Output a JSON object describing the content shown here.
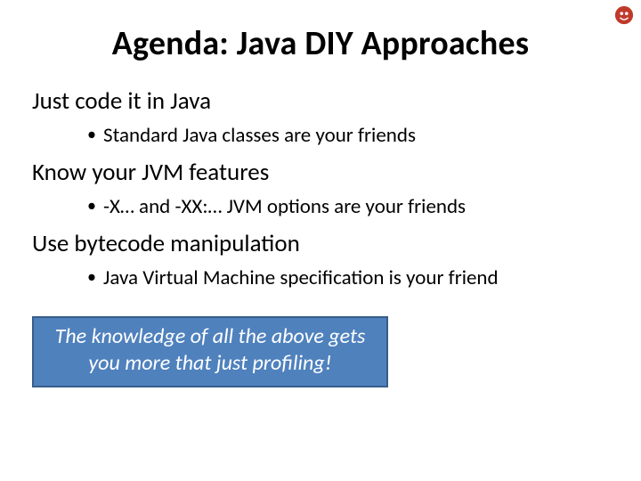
{
  "title": "Agenda: Java DIY Approaches",
  "items": [
    {
      "text": "Just code it in Java",
      "sub": [
        "Standard Java classes are your friends"
      ]
    },
    {
      "text": "Know your JVM features",
      "sub": [
        "-X… and -XX:… JVM options are your friends"
      ]
    },
    {
      "text": "Use bytecode manipulation",
      "sub": [
        "Java Virtual Machine specification is your friend"
      ]
    }
  ],
  "callout": "The knowledge of all the above gets you more that just profiling!",
  "colors": {
    "callout_bg": "#4f81bd",
    "callout_border": "#385d8a"
  },
  "bullet_char": "•"
}
